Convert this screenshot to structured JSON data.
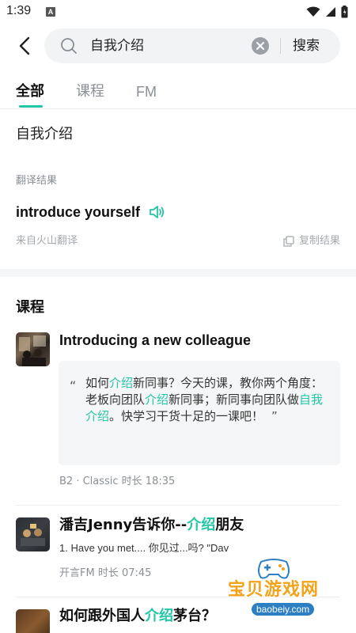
{
  "status_bar": {
    "time": "1:39",
    "notification_letter": "A",
    "icons": [
      "wifi-icon",
      "signal-icon",
      "battery-icon"
    ]
  },
  "search": {
    "query": "自我介绍",
    "submit_label": "搜索"
  },
  "tabs": [
    {
      "label": "全部",
      "active": true
    },
    {
      "label": "课程",
      "active": false
    },
    {
      "label": "FM",
      "active": false
    }
  ],
  "query_display": "自我介绍",
  "translation": {
    "label": "翻译结果",
    "result": "introduce yourself",
    "source": "来自火山翻译",
    "copy_label": "复制结果"
  },
  "courses_section": {
    "title": "课程",
    "items": [
      {
        "title": "Introducing a new colleague",
        "quote_parts": [
          "如何",
          "介绍",
          "新同事？今天的课，教你两个角度：老板向团队",
          "介绍",
          "新同事；新同事向团队做",
          "自我介绍",
          "。快学习干货十足的一课吧！"
        ],
        "quote_open": "“",
        "quote_close": "”",
        "meta": "B2 · Classic 时长 18:35"
      },
      {
        "title_parts": [
          "潘吉Jenny告诉你--",
          "介绍",
          "朋友"
        ],
        "excerpt": "1. Have you met.... 你见过...吗?    \"Dav",
        "meta": "开言FM 时长 07:45"
      },
      {
        "title_parts": [
          "如何跟外国人",
          "介绍",
          "茅台？"
        ]
      }
    ]
  },
  "watermark": {
    "title": "宝贝游戏网",
    "domain": "baobeiy.com"
  },
  "colors": {
    "accent": "#22c6a4",
    "text_primary": "#111111",
    "text_secondary": "#8a8f96",
    "search_bg": "#f2f3f5",
    "section_gap": "#f4f5f7"
  }
}
